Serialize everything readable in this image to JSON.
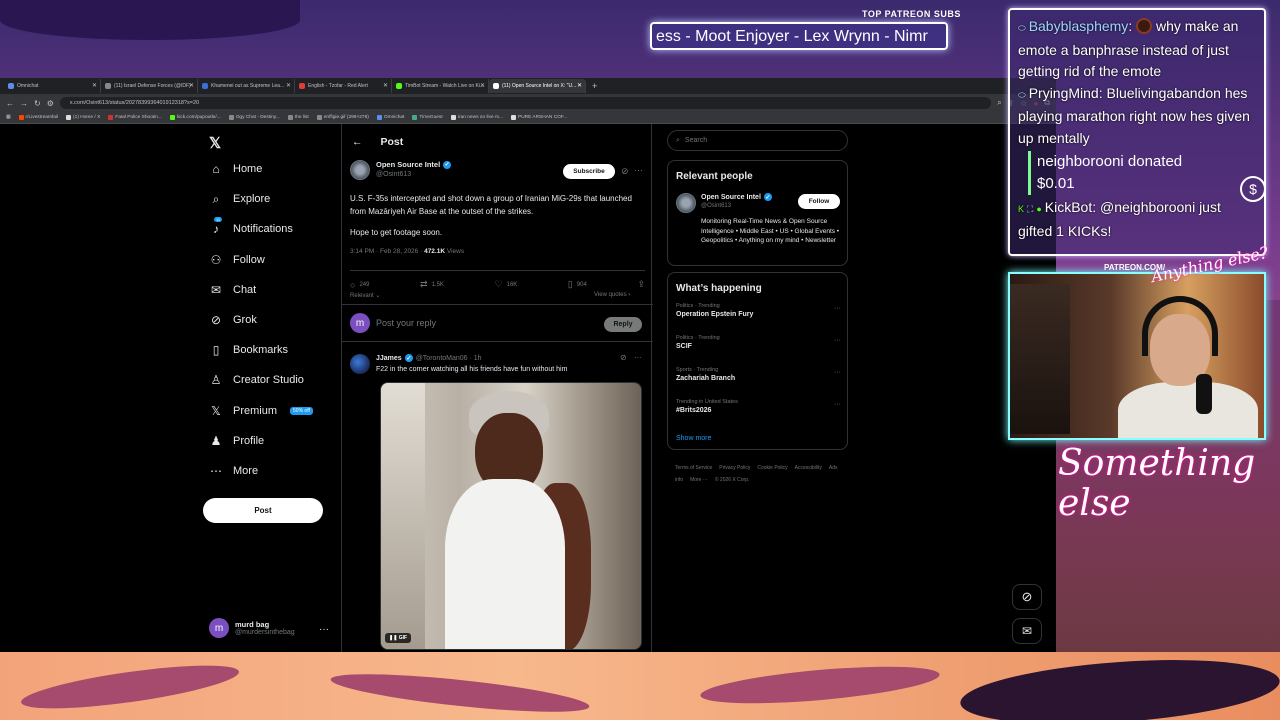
{
  "overlay": {
    "patreon_title": "TOP PATREON SUBS",
    "patreon_ticker": "ess - Moot Enjoyer - Lex Wrynn - Nimr",
    "patreon_url": "PATREON.COM/",
    "signature": "Something else",
    "signature_top": "Anything else?"
  },
  "chat": {
    "lines": [
      {
        "user": "Babyblasphemy",
        "sep": ":",
        "text": " why make an emote a banphrase instead of just getting rid of the emote"
      },
      {
        "user": "PryingMind",
        "sep": ":",
        "text": " Bluelivingabandon hes playing marathon right now hes given up mentally"
      }
    ],
    "donation": {
      "line1": "neighborooni donated",
      "line2": "$0.01"
    },
    "kickbot": {
      "user": "KickBot",
      "sep": ":",
      "text": " @neighborooni just gifted 1 KICKs!"
    }
  },
  "browser": {
    "tabs": [
      {
        "label": "Omnichat",
        "color": "#5b8def",
        "active": false
      },
      {
        "label": "(11) Israel Defense Forces (@IDF)",
        "color": "#888",
        "active": false
      },
      {
        "label": "Khamenei out as Supreme Lea...",
        "color": "#3b6fd8",
        "active": false
      },
      {
        "label": "English - Tzofar - Red Alert",
        "color": "#e23b3b",
        "active": false
      },
      {
        "label": "TimBot Stream - Watch Live on Ki...",
        "color": "#53fc18",
        "active": false
      },
      {
        "label": "(11) Open Source Intel on X: \"U...",
        "color": "#fff",
        "active": true
      }
    ],
    "url": "x.com/Osint613/status/2027839936401912318?s=20",
    "bookmarks": [
      {
        "label": "r/Livestreamfail",
        "color": "#ff4500"
      },
      {
        "label": "(1) Home / X",
        "color": "#ddd"
      },
      {
        "label": "Fatal Police Shootin...",
        "color": "#c33"
      },
      {
        "label": "kick.com/pupoutle/...",
        "color": "#53fc18"
      },
      {
        "label": "Ogy Chat - Destiny...",
        "color": "#888"
      },
      {
        "label": "the list",
        "color": "#888"
      },
      {
        "label": "enffigie.gif (299×278)",
        "color": "#888"
      },
      {
        "label": "Omnichat",
        "color": "#5b8def"
      },
      {
        "label": "TimeGuesr",
        "color": "#4a8"
      },
      {
        "label": "iran news on live m...",
        "color": "#ddd"
      },
      {
        "label": "PURE ARSHAN COF...",
        "color": "#ddd"
      }
    ]
  },
  "nav": {
    "items": [
      {
        "label": "Home",
        "icon": "⌂"
      },
      {
        "label": "Explore",
        "icon": "⌕"
      },
      {
        "label": "Notifications",
        "icon": "♪",
        "badge": "11"
      },
      {
        "label": "Follow",
        "icon": "⚇"
      },
      {
        "label": "Chat",
        "icon": "✉"
      },
      {
        "label": "Grok",
        "icon": "⊘"
      },
      {
        "label": "Bookmarks",
        "icon": "▯"
      },
      {
        "label": "Creator Studio",
        "icon": "♙"
      },
      {
        "label": "Premium",
        "icon": "𝕏",
        "badge": "50% off"
      },
      {
        "label": "Profile",
        "icon": "♟"
      },
      {
        "label": "More",
        "icon": "⋯"
      }
    ],
    "post_label": "Post",
    "account": {
      "name": "murd bag",
      "handle": "@murdersinthebag",
      "initial": "m"
    }
  },
  "post": {
    "header": "Post",
    "author": "Open Source Intel",
    "handle": "@Osint613",
    "subscribe": "Subscribe",
    "text": "U.S. F-35s intercepted and shot down a group of Iranian MiG-29s that launched from Mazāriyeh Air Base at the outset of the strikes.",
    "text2": "Hope to get footage soon.",
    "time": "3:14 PM · Feb 28, 2026 · ",
    "views": "472.1K",
    "views_label": " Views",
    "replies": "249",
    "reposts": "1.5K",
    "likes": "16K",
    "bookmarks": "904",
    "relevant": "Relevant",
    "view_quotes": "View quotes",
    "reply_placeholder": "Post your reply",
    "reply_button": "Reply",
    "reply_initial": "m"
  },
  "comment": {
    "name": "JJames",
    "handle": "@TorontoMan06 · 1h",
    "text": "F22 in the corner watching all his friends have fun without him",
    "gif_label": "GIF"
  },
  "sidebar": {
    "search_placeholder": "Search",
    "relevant_title": "Relevant people",
    "rp_name": "Open Source Intel",
    "rp_handle": "@Osint613",
    "follow": "Follow",
    "rp_bio": "Monitoring Real-Time News & Open Source Intelligence • Middle East • US • Global Events • Geopolitics • Anything on my mind • Newsletter",
    "happening_title": "What’s happening",
    "trends": [
      {
        "cat": "Politics · Trending",
        "name": "Operation Epstein Fury"
      },
      {
        "cat": "Politics · Trending",
        "name": "SCIF"
      },
      {
        "cat": "Sports · Trending",
        "name": "Zachariah Branch"
      },
      {
        "cat": "Trending in United States",
        "name": "#Brits2026"
      }
    ],
    "show_more": "Show more",
    "footer": [
      "Terms of Service",
      "Privacy Policy",
      "Cookie Policy",
      "Accessibility",
      "Ads info",
      "More ···",
      "© 2026 X Corp."
    ]
  }
}
